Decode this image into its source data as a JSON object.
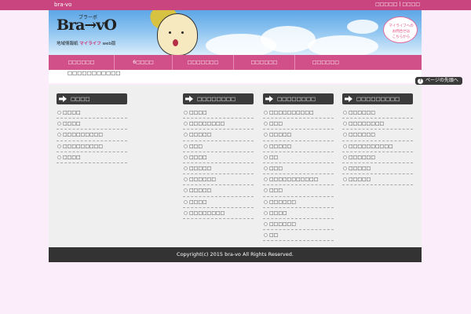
{
  "topbar": {
    "site_name": "bra-vo",
    "link_1": "□□□□□",
    "separator": "|",
    "link_2": "□□□□"
  },
  "header": {
    "logo_text": "Bra→vO",
    "logo_ruby": "ブラーボ",
    "logo_sub_prefix": "地域情報紙",
    "logo_sub_brand": "マイライフ",
    "logo_sub_suffix": "web版",
    "bubble_line_1": "マイライフへの",
    "bubble_line_2": "お問合せは",
    "bubble_line_3": "こちらから"
  },
  "nav": {
    "items": [
      {
        "label": "□□□□□□"
      },
      {
        "label": "6□□□□"
      },
      {
        "label": "□□□□□□□"
      },
      {
        "label": "□□□□□□"
      },
      {
        "label": "□□□□□□"
      }
    ]
  },
  "breadcrumb": {
    "text": "□□□□□□□□□□□"
  },
  "back_to_top": {
    "label": "ページの先頭へ"
  },
  "columns": [
    {
      "title": "□□□□",
      "items": [
        "□□□□",
        "□□□□",
        "□□□□□□□□□",
        "□□□□□□□□□",
        "□□□□"
      ]
    },
    {
      "title": "□□□□□□□□",
      "items": [
        "□□□□",
        "□□□□□□□□",
        "□□□□□",
        "□□□",
        "□□□□",
        "□□□□□",
        "□□□□□□",
        "□□□□□",
        "□□□□",
        "□□□□□□□□"
      ]
    },
    {
      "title": "□□□□□□□□",
      "items": [
        "□□□□□□□□□□",
        "□□□",
        "□□□□□",
        "□□□□□",
        "□□",
        "□□□",
        "□□□□□□□□□□□",
        "□□□",
        "□□□□□□",
        "□□□□",
        "□□□□□□",
        "□□"
      ]
    },
    {
      "title": "□□□□□□□□□",
      "items": [
        "□□□□□□",
        "□□□□□□□□",
        "□□□□□□",
        "□□□□□□□□□□",
        "□□□□□□",
        "□□□□□",
        "□□□□□"
      ]
    }
  ],
  "footer": {
    "copyright": "Copyright(c) 2015 bra-vo All Rights Reserved."
  },
  "colors": {
    "brand_pink": "#c9457f",
    "nav_pink": "#d1508a",
    "dark": "#333333",
    "page_bg": "#fbeefa"
  },
  "icons": {
    "column_heading": "arrow-right-icon",
    "list_bullet": "circle-bullet-icon",
    "back_to_top": "question-circle-icon"
  }
}
